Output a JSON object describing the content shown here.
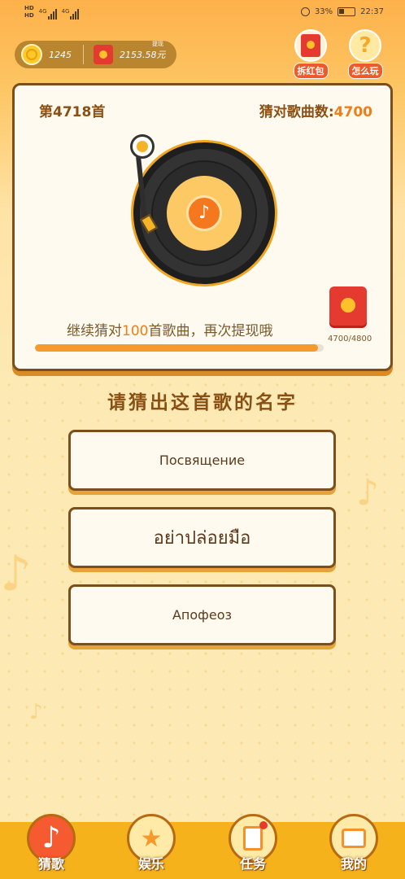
{
  "status_bar": {
    "network": "4G",
    "battery": "33%",
    "time": "22:37"
  },
  "wallet": {
    "coins": "1245",
    "cash": "2153.58元",
    "cash_label": "提现"
  },
  "top_buttons": {
    "red_packet": "拆红包",
    "how_to_play": "怎么玩"
  },
  "card": {
    "round": "第4718首",
    "score_label": "猜对歌曲数:",
    "score_value": "4700",
    "progress_text_prefix": "继续猜对",
    "progress_text_number": "100",
    "progress_text_suffix": "首歌曲，再次提现哦",
    "progress": 0.979,
    "reward_count": "4700/4800"
  },
  "question": "请猜出这首歌的名字",
  "options": [
    "Посвящение",
    "อย่าปล่อยมือ",
    "Апофеоз"
  ],
  "bottom_nav": [
    "猜歌",
    "娱乐",
    "任务",
    "我的"
  ],
  "icons": {
    "note": "music-note-icon",
    "star": "star-icon",
    "task": "task-icon",
    "wallet": "wallet-icon"
  },
  "colors": {
    "accent": "#f07e18",
    "brown": "#7a4e1d",
    "nav": "#f5b21b"
  }
}
